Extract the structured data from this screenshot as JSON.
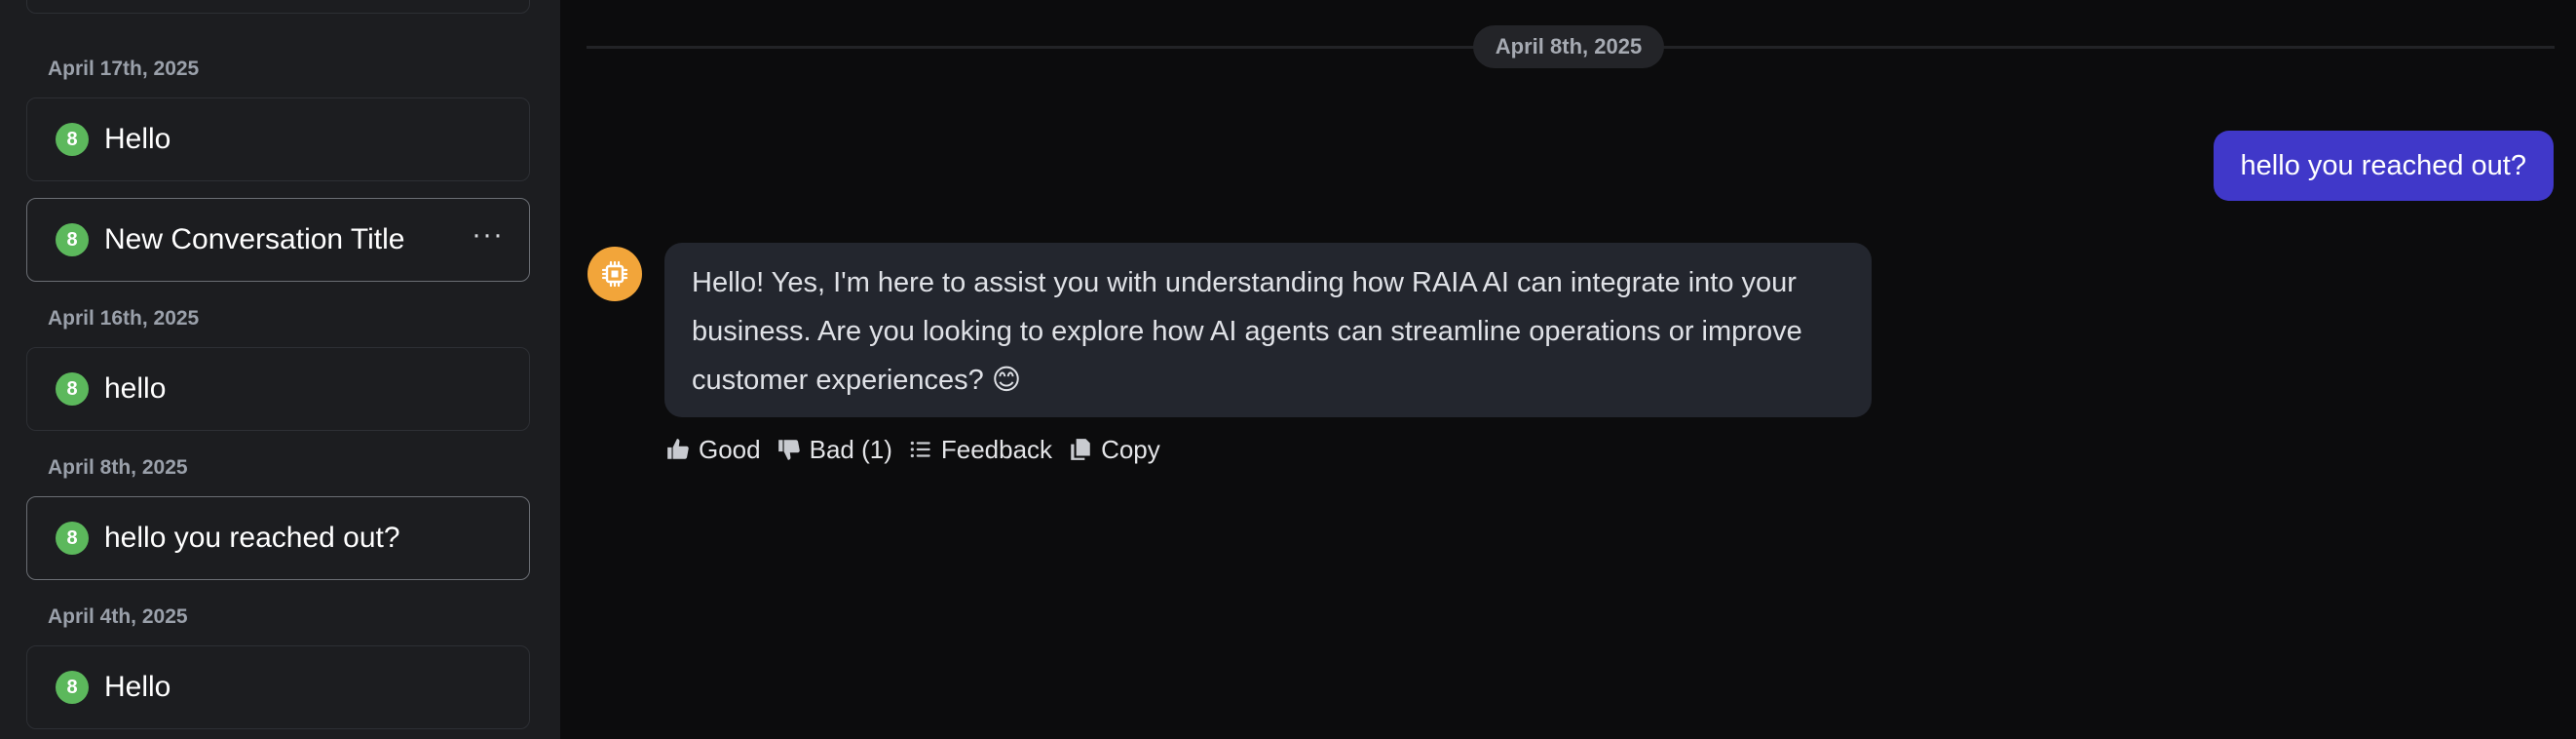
{
  "sidebar": {
    "groups": [
      {
        "date": "April 17th, 2025"
      },
      {
        "date": "April 16th, 2025"
      },
      {
        "date": "April 8th, 2025"
      },
      {
        "date": "April 4th, 2025"
      }
    ],
    "conversations": [
      {
        "badge": "8",
        "title": "Hello"
      },
      {
        "badge": "8",
        "title": "New Conversation Title",
        "more": "···"
      },
      {
        "badge": "8",
        "title": "hello"
      },
      {
        "badge": "8",
        "title": "hello you reached out?"
      },
      {
        "badge": "8",
        "title": "Hello"
      }
    ]
  },
  "chat": {
    "date_divider": "April 8th, 2025",
    "user_message": "hello you reached out?",
    "assistant_message": "Hello! Yes, I'm here to assist you with understanding how RAIA AI can integrate into your business. Are you looking to explore how AI agents can streamline operations or improve customer experiences? 😊",
    "assistant_avatar_icon": "chip-icon",
    "actions": {
      "good": "Good",
      "bad": "Bad (1)",
      "feedback": "Feedback",
      "copy": "Copy"
    }
  },
  "colors": {
    "user_bubble": "#4038c9",
    "assistant_bubble": "#23262e",
    "badge": "#5cb85c",
    "avatar": "#f2a53a"
  }
}
